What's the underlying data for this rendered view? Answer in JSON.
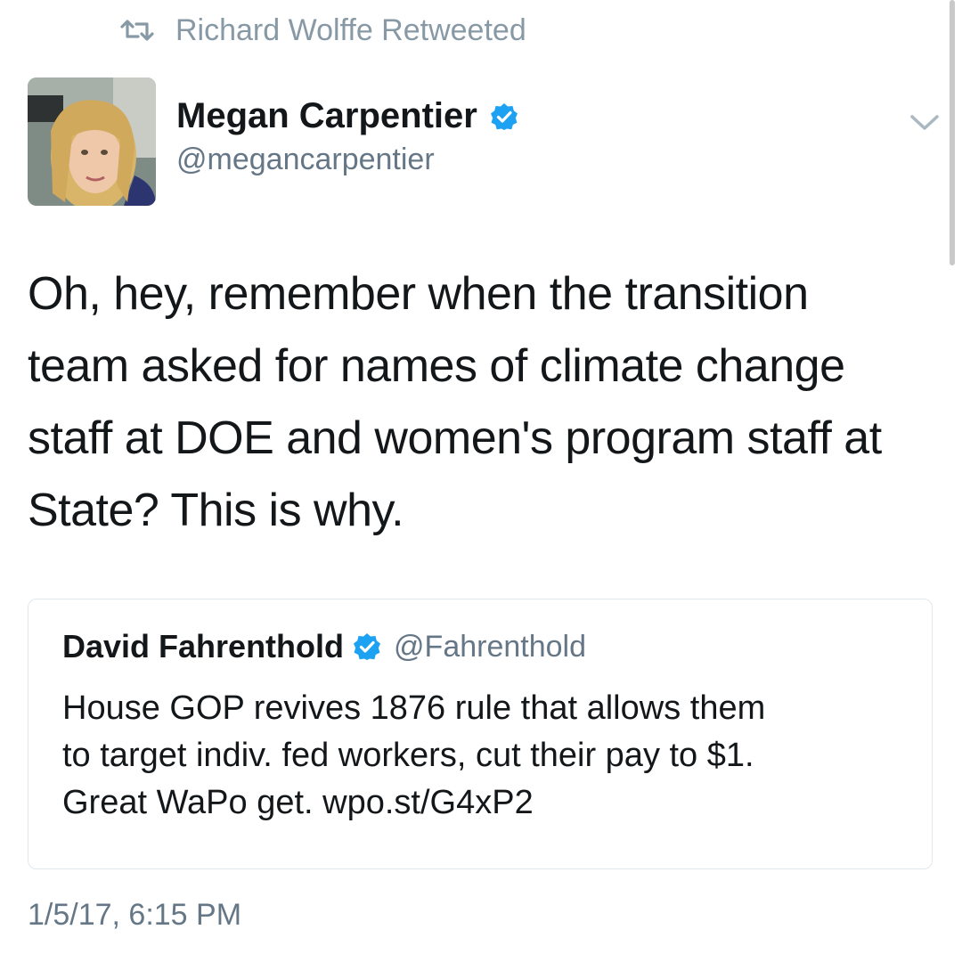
{
  "retweet": {
    "text": "Richard Wolffe Retweeted",
    "icon": "retweet-icon"
  },
  "author": {
    "name": "Megan Carpentier",
    "handle": "@megancarpentier",
    "verified": true,
    "avatar_icon": "avatar"
  },
  "tweet": {
    "text": "Oh, hey, remember when the transition\nteam asked for names of climate change\nstaff at DOE and women's program staff at\nState? This is why."
  },
  "quoted": {
    "name": "David Fahrenthold",
    "handle": "@Fahrenthold",
    "verified": true,
    "text": "House GOP revives 1876 rule that allows them\nto target indiv. fed workers, cut their pay to $1.\nGreat WaPo get. wpo.st/G4xP2"
  },
  "timestamp": "1/5/17, 6:15 PM",
  "colors": {
    "verified_blue": "#1da1f2",
    "muted": "#657786",
    "border": "#e1e8ed"
  }
}
